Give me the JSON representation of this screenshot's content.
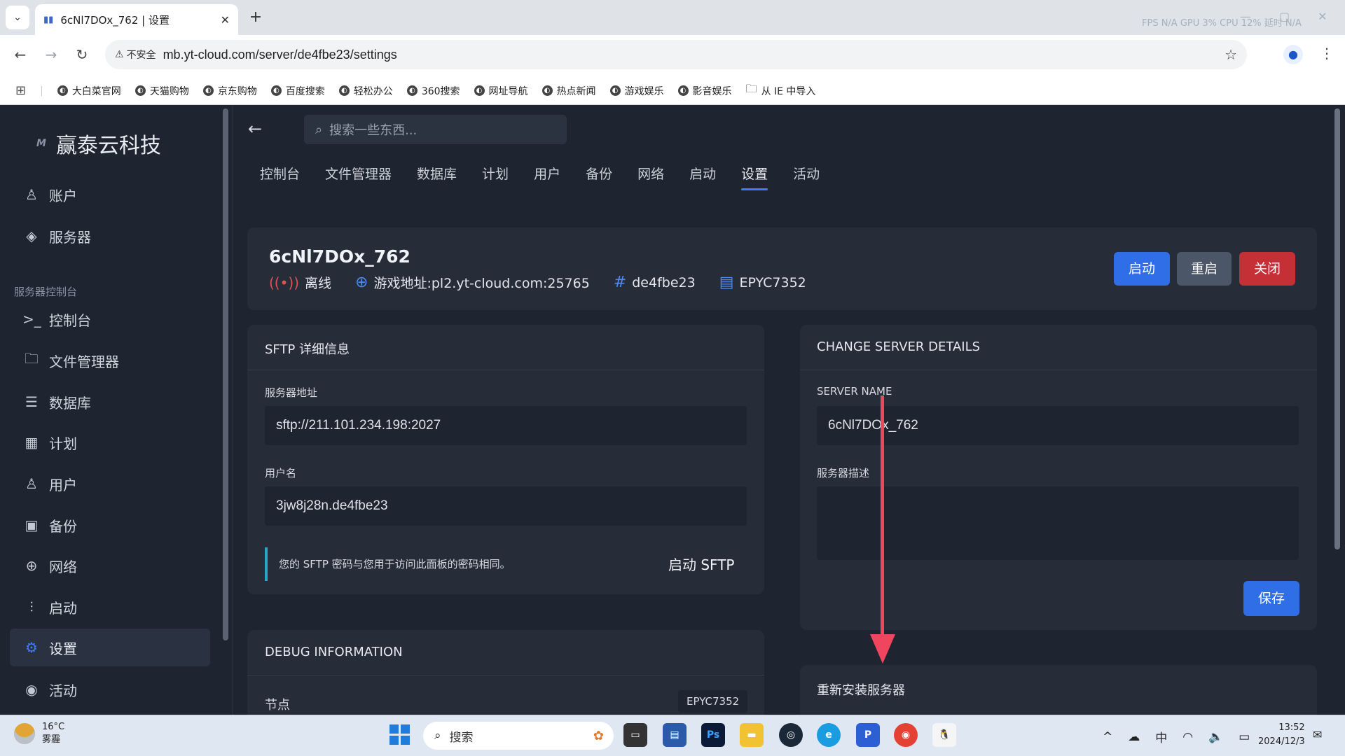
{
  "browser": {
    "tab_title": "6cNl7DOx_762 | 设置",
    "tab_close": "✕",
    "new_tab": "+",
    "win_stats": "FPS  N/A  GPU  3%  CPU  12%  延时  N/A",
    "insecure_label": "不安全",
    "url": "mb.yt-cloud.com/server/de4fbe23/settings",
    "bookmarks": [
      "大白菜官网",
      "天猫购物",
      "京东购物",
      "百度搜索",
      "轻松办公",
      "360搜索",
      "网址导航",
      "热点新闻",
      "游戏娱乐",
      "影音娱乐",
      "从 IE 中导入"
    ]
  },
  "sidebar": {
    "brand": "赢泰云科技",
    "brand_mark": "M",
    "top_items": [
      {
        "label": "账户",
        "icon": "user-icon"
      },
      {
        "label": "服务器",
        "icon": "layers-icon"
      }
    ],
    "section_label": "服务器控制台",
    "items": [
      {
        "label": "控制台",
        "icon": "terminal-icon"
      },
      {
        "label": "文件管理器",
        "icon": "folder-icon"
      },
      {
        "label": "数据库",
        "icon": "database-icon"
      },
      {
        "label": "计划",
        "icon": "calendar-icon"
      },
      {
        "label": "用户",
        "icon": "users-icon"
      },
      {
        "label": "备份",
        "icon": "save-icon"
      },
      {
        "label": "网络",
        "icon": "globe-icon"
      },
      {
        "label": "启动",
        "icon": "sliders-icon"
      },
      {
        "label": "设置",
        "icon": "gear-icon",
        "active": true
      },
      {
        "label": "活动",
        "icon": "eye-icon"
      }
    ]
  },
  "main": {
    "search_placeholder": "搜索一些东西...",
    "tabs": [
      "控制台",
      "文件管理器",
      "数据库",
      "计划",
      "用户",
      "备份",
      "网络",
      "启动",
      "设置",
      "活动"
    ],
    "active_tab": "设置",
    "server": {
      "name": "6cNl7DOx_762",
      "status": "离线",
      "address": "游戏地址:pl2.yt-cloud.com:25765",
      "id": "de4fbe23",
      "node": "EPYC7352"
    },
    "actions": {
      "start": "启动",
      "restart": "重启",
      "stop": "关闭"
    },
    "sftp": {
      "title": "SFTP 详细信息",
      "address_label": "服务器地址",
      "address_value": "sftp://211.101.234.198:2027",
      "username_label": "用户名",
      "username_value": "3jw8j28n.de4fbe23",
      "note": "您的 SFTP 密码与您用于访问此面板的密码相同。",
      "launch_label": "启动 SFTP"
    },
    "details": {
      "title": "CHANGE SERVER DETAILS",
      "name_label": "SERVER NAME",
      "name_value": "6cNl7DOx_762",
      "desc_label": "服务器描述",
      "desc_value": "",
      "save_label": "保存"
    },
    "debug": {
      "title": "DEBUG INFORMATION",
      "node_label": "节点",
      "node_value": "EPYC7352"
    },
    "reinstall": {
      "title": "重新安装服务器"
    }
  },
  "taskbar": {
    "weather_temp": "16°C",
    "weather_desc": "雾霾",
    "search_label": "搜索",
    "ime": "中",
    "time": "13:52",
    "date": "2024/12/3"
  },
  "colors": {
    "accent": "#2f6ee6",
    "danger": "#c52f36",
    "annotation_arrow": "#f0455e"
  }
}
